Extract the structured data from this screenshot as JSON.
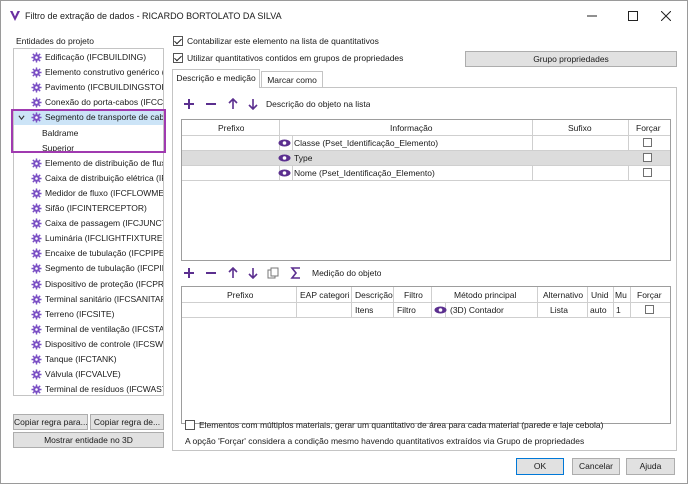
{
  "window": {
    "title": "Filtro de extração de dados - RICARDO BORTOLATO DA SILVA",
    "minimize_icon": "minimize-icon",
    "maximize_icon": "maximize-icon",
    "close_icon": "close-icon"
  },
  "left_panel": {
    "label": "Entidades do projeto",
    "items": [
      {
        "label": "Edificação (IFCBUILDING)"
      },
      {
        "label": "Elemento construtivo genérico (I"
      },
      {
        "label": "Pavimento (IFCBUILDINGSTOREY"
      },
      {
        "label": "Conexão do porta-cabos (IFCCAI"
      },
      {
        "label": "Segmento de transporte de cabo"
      },
      {
        "label": "Baldrame"
      },
      {
        "label": "Superior"
      },
      {
        "label": "Elemento de distribuição de flux"
      },
      {
        "label": "Caixa de distribuição elétrica (IFC"
      },
      {
        "label": "Medidor de fluxo (IFCFLOWMETI"
      },
      {
        "label": "Sifão (IFCINTERCEPTOR)"
      },
      {
        "label": "Caixa de passagem (IFCJUNCTIO"
      },
      {
        "label": "Luminária (IFCLIGHTFIXTURE)"
      },
      {
        "label": "Encaixe de tubulação (IFCPIPEFIT"
      },
      {
        "label": "Segmento de tubulação (IFCPIPE"
      },
      {
        "label": "Dispositivo de proteção (IFCPRO"
      },
      {
        "label": "Terminal sanitário (IFCSANITARY"
      },
      {
        "label": "Terreno (IFCSITE)"
      },
      {
        "label": "Terminal de ventilação (IFCSTACI"
      },
      {
        "label": "Dispositivo de controle (IFCSWIT"
      },
      {
        "label": "Tanque (IFCTANK)"
      },
      {
        "label": "Válvula (IFCVALVE)"
      },
      {
        "label": "Terminal de resíduos (IFCWASTE"
      }
    ],
    "copy_rule_from": "Copiar regra para...",
    "copy_rule_to": "Copiar regra de...",
    "show_3d": "Mostrar entidade no 3D"
  },
  "options": {
    "count_element": "Contabilizar este elemento na lista de quantitativos",
    "use_groups": "Utilizar quantitativos contidos em grupos de propriedades",
    "group_button": "Grupo propriedades"
  },
  "tabs": [
    {
      "label": "Descrição e medição"
    },
    {
      "label": "Marcar como"
    }
  ],
  "description_section": {
    "label": "Descrição do objeto na lista",
    "headers": [
      "Prefixo",
      "Informação",
      "Sufixo",
      "Forçar"
    ],
    "rows": [
      {
        "info": "Classe (Pset_Identificação_Elemento)"
      },
      {
        "info": "Type"
      },
      {
        "info": "Nome (Pset_Identificação_Elemento)"
      }
    ]
  },
  "measurement_section": {
    "label": "Medição do objeto",
    "headers": [
      "Prefixo",
      "EAP categori",
      "Descrição",
      "Filtro",
      "Método principal",
      "Alternativo",
      "Unid",
      "Mu",
      "Forçar"
    ],
    "rows": [
      {
        "descricao": "Itens",
        "filtro": "Filtro",
        "metodo": "(3D) Contador",
        "alternativo": "Lista",
        "unid": "auto",
        "mu": "1"
      }
    ]
  },
  "footer": {
    "multi_material": "Elementos com múltiplos materiais, gerar um quantitativo de área para cada material (parede e laje cebola)",
    "note": "A opção 'Forçar' considera a condição mesmo havendo quantitativos extraídos via Grupo de propriedades"
  },
  "buttons": {
    "ok": "OK",
    "cancel": "Cancelar",
    "help": "Ajuda"
  },
  "colors": {
    "accent": "#a03ab0",
    "gear": "#7a4fc4",
    "eye": "#5b2f8f",
    "selected_row": "#dcdcdc",
    "tool_icon": "#5b2f8f"
  }
}
